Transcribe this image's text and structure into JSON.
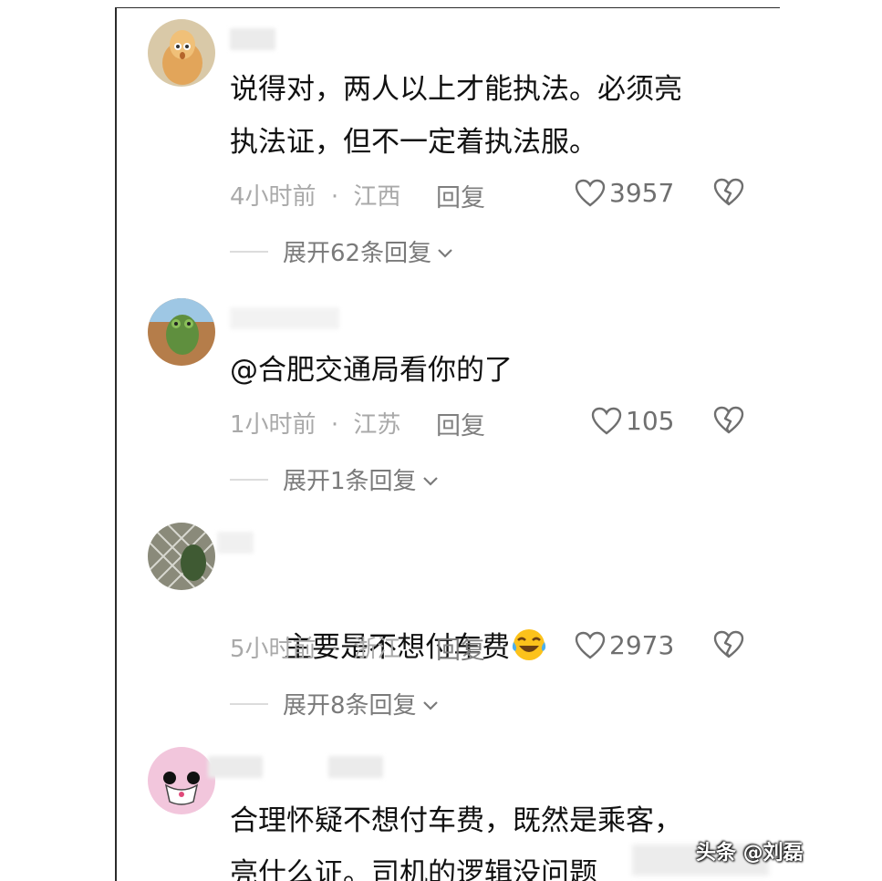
{
  "comments": [
    {
      "text": "说得对，两人以上才能执法。必须亮\n执法证，但不一定着执法服。",
      "time": "4小时前",
      "location": "江西",
      "reply_label": "回复",
      "likes": "3957",
      "expand_label": "展开62条回复"
    },
    {
      "text": "@合肥交通局看你的了",
      "time": "1小时前",
      "location": "江苏",
      "reply_label": "回复",
      "likes": "105",
      "expand_label": "展开1条回复"
    },
    {
      "text": "主要是不想付车费",
      "time": "5小时前",
      "location": "浙江",
      "reply_label": "回复",
      "likes": "2973",
      "expand_label": "展开8条回复"
    },
    {
      "text": "合理怀疑不想付车费，既然是乘客，\n亮什么证。司机的逻辑没问题"
    }
  ],
  "meta_separator": "·",
  "watermark": "头条 @刘磊",
  "icons": {
    "like": "heart-outline-icon",
    "dislike": "broken-heart-icon",
    "expand": "chevron-down-icon",
    "emoji": "laughing-tears-emoji-icon"
  },
  "colors": {
    "text": "#111111",
    "meta": "#a9a9a9",
    "secondary": "#7a7a7a"
  }
}
